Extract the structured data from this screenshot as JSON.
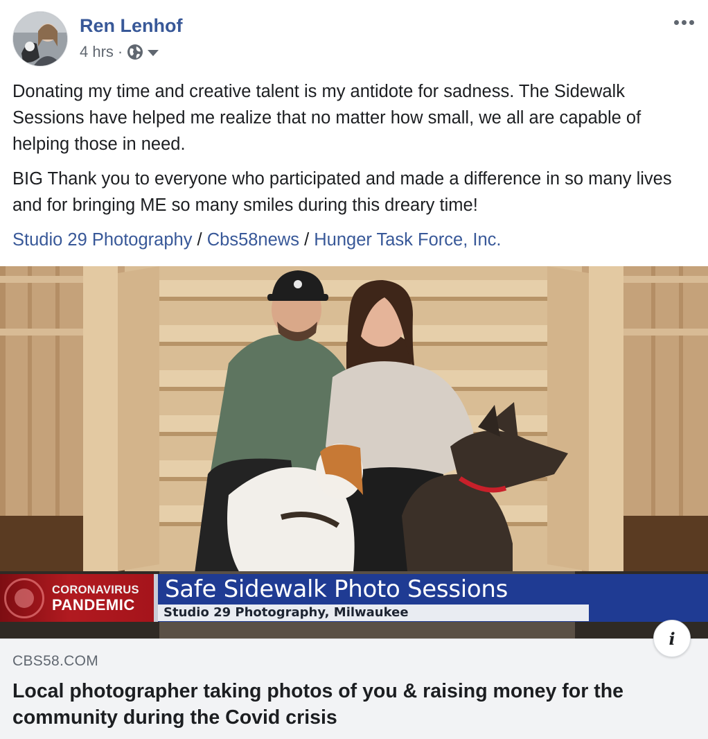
{
  "post": {
    "author": "Ren Lenhof",
    "time": "4 hrs",
    "separator": "·",
    "privacy_icon": "globe-icon",
    "menu_icon": "more-options-icon",
    "paragraphs": [
      "Donating my time and creative talent is my antidote for sadness. The Sidewalk Sessions have helped me realize that no matter how small, we all are capable of helping those in need.",
      "BIG Thank you to everyone who participated and made a difference in so many lives and for bringing ME so many smiles during this dreary time!"
    ],
    "tags": [
      "Studio 29 Photography",
      "Cbs58news",
      "Hunger Task Force, Inc."
    ],
    "tag_separator": "/"
  },
  "link": {
    "banner_top_line1": "CORONAVIRUS",
    "banner_top_line2": "PANDEMIC",
    "banner_headline": "Safe Sidewalk Photo Sessions",
    "banner_subline": "Studio 29 Photography, Milwaukee",
    "info_icon_label": "i",
    "domain": "CBS58.COM",
    "title": "Local photographer taking photos of you & raising money for the community during the Covid crisis"
  },
  "colors": {
    "link_blue": "#385898",
    "meta_gray": "#606770",
    "banner_blue": "#1f3b93",
    "banner_red": "#b11a20",
    "caption_bg": "#f2f3f5"
  }
}
